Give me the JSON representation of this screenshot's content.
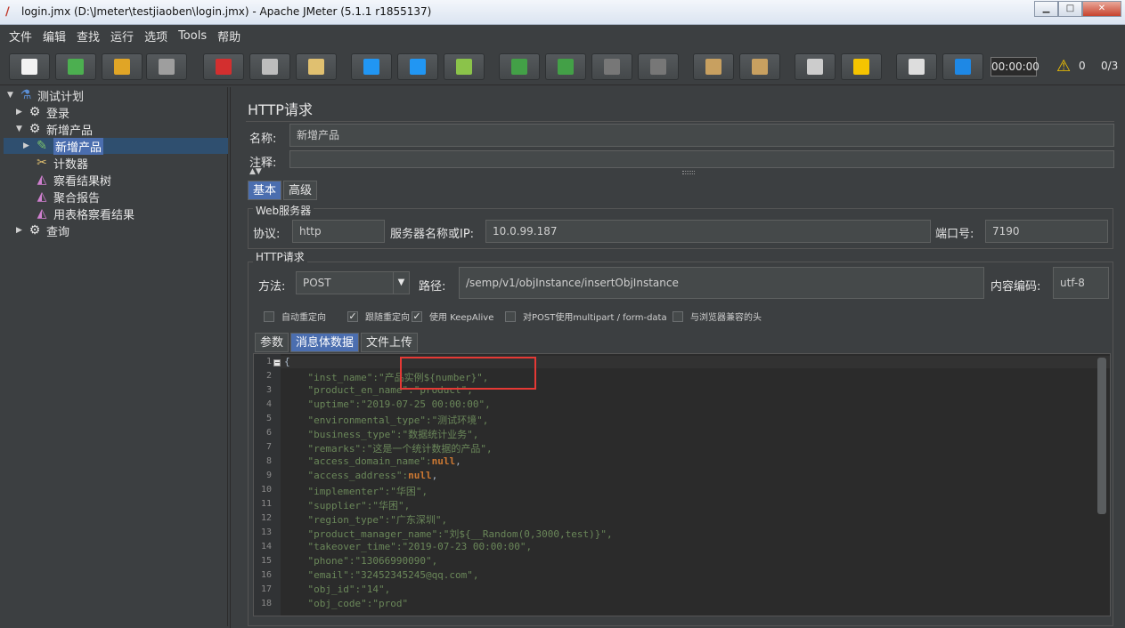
{
  "window": {
    "title": "login.jmx (D:\\Jmeter\\testjiaoben\\login.jmx) - Apache JMeter (5.1.1 r1855137)",
    "minimize": "▁",
    "maximize": "□",
    "close": "✕"
  },
  "menubar": {
    "items": [
      "文件",
      "编辑",
      "查找",
      "运行",
      "选项",
      "Tools",
      "帮助"
    ]
  },
  "toolbar": {
    "buttons": [
      {
        "name": "new-icon",
        "color": "#f2f2f2"
      },
      {
        "name": "templates-icon",
        "color": "#4caf50"
      },
      {
        "name": "open-icon",
        "color": "#e0a526"
      },
      {
        "name": "save-icon",
        "color": "#9e9e9e"
      },
      {
        "name": "cut-icon",
        "color": "#d32f2f"
      },
      {
        "name": "copy-icon",
        "color": "#bdbdbd"
      },
      {
        "name": "paste-icon",
        "color": "#e0c070"
      },
      {
        "name": "expand-icon",
        "color": "#2196f3"
      },
      {
        "name": "collapse-icon",
        "color": "#2196f3"
      },
      {
        "name": "toggle-icon",
        "color": "#8bc34a"
      },
      {
        "name": "start-icon",
        "color": "#43a047"
      },
      {
        "name": "start-no-pause-icon",
        "color": "#43a047"
      },
      {
        "name": "stop-icon",
        "color": "#777777"
      },
      {
        "name": "shutdown-icon",
        "color": "#777777"
      },
      {
        "name": "clear-icon",
        "color": "#c8a060"
      },
      {
        "name": "clear-all-icon",
        "color": "#c8a060"
      },
      {
        "name": "search-icon",
        "color": "#cccccc"
      },
      {
        "name": "reset-search-icon",
        "color": "#f5c400"
      },
      {
        "name": "function-helper-icon",
        "color": "#dddddd"
      },
      {
        "name": "help-icon",
        "color": "#1e88e5"
      }
    ],
    "timer": "00:00:00",
    "warnings": "0",
    "threads": "0/3"
  },
  "tree": {
    "items": [
      {
        "label": "测试计划",
        "icon": "flask-icon"
      },
      {
        "label": "登录",
        "icon": "gear-icon"
      },
      {
        "label": "新增产品",
        "icon": "gear-icon"
      },
      {
        "label": "新增产品",
        "icon": "sampler-icon"
      },
      {
        "label": "计数器",
        "icon": "tools-icon"
      },
      {
        "label": "察看结果树",
        "icon": "chart-icon"
      },
      {
        "label": "聚合报告",
        "icon": "chart-icon"
      },
      {
        "label": "用表格察看结果",
        "icon": "chart-icon"
      },
      {
        "label": "查询",
        "icon": "gear-icon"
      }
    ]
  },
  "panel": {
    "title": "HTTP请求",
    "name_label": "名称:",
    "name_value": "新增产品",
    "comment_label": "注释:",
    "tabs": [
      "基本",
      "高级"
    ],
    "web_server": {
      "title": "Web服务器",
      "protocol_label": "协议:",
      "protocol_value": "http",
      "server_label": "服务器名称或IP:",
      "server_value": "10.0.99.187",
      "port_label": "端口号:",
      "port_value": "7190"
    },
    "http_request": {
      "title": "HTTP请求",
      "method_label": "方法:",
      "method_value": "POST",
      "path_label": "路径:",
      "path_value": "/semp/v1/objInstance/insertObjInstance",
      "encoding_label": "内容编码:",
      "encoding_value": "utf-8"
    },
    "checkboxes": [
      {
        "label": "自动重定向",
        "checked": false
      },
      {
        "label": "跟随重定向",
        "checked": true
      },
      {
        "label": "使用 KeepAlive",
        "checked": true
      },
      {
        "label": "对POST使用multipart / form-data",
        "checked": false
      },
      {
        "label": "与浏览器兼容的头",
        "checked": false
      }
    ],
    "body_tabs": [
      "参数",
      "消息体数据",
      "文件上传"
    ]
  },
  "editor": {
    "line_numbers": [
      "1",
      "2",
      "3",
      "4",
      "5",
      "6",
      "7",
      "8",
      "9",
      "10",
      "11",
      "12",
      "13",
      "14",
      "15",
      "16",
      "17",
      "18"
    ],
    "lines": [
      "{",
      "    \"inst_name\":\"产品实例${number}\",",
      "    \"product_en_name\":\"product\",",
      "    \"uptime\":\"2019-07-25 00:00:00\",",
      "    \"environmental_type\":\"测试环境\",",
      "    \"business_type\":\"数据统计业务\",",
      "    \"remarks\":\"这是一个统计数据的产品\",",
      "    \"access_domain_name\":",
      "    \"access_address\":",
      "    \"implementer\":\"华困\",",
      "    \"supplier\":\"华困\",",
      "    \"region_type\":\"广东深圳\",",
      "    \"product_manager_name\":\"刘${__Random(0,3000,test)}\",",
      "    \"takeover_time\":\"2019-07-23 00:00:00\",",
      "    \"phone\":\"13066990090\",",
      "    \"email\":\"32452345245@qq.com\",",
      "    \"obj_id\":\"14\",",
      "    \"obj_code\":\"prod\""
    ],
    "null_kw": "null",
    "comma": ","
  }
}
